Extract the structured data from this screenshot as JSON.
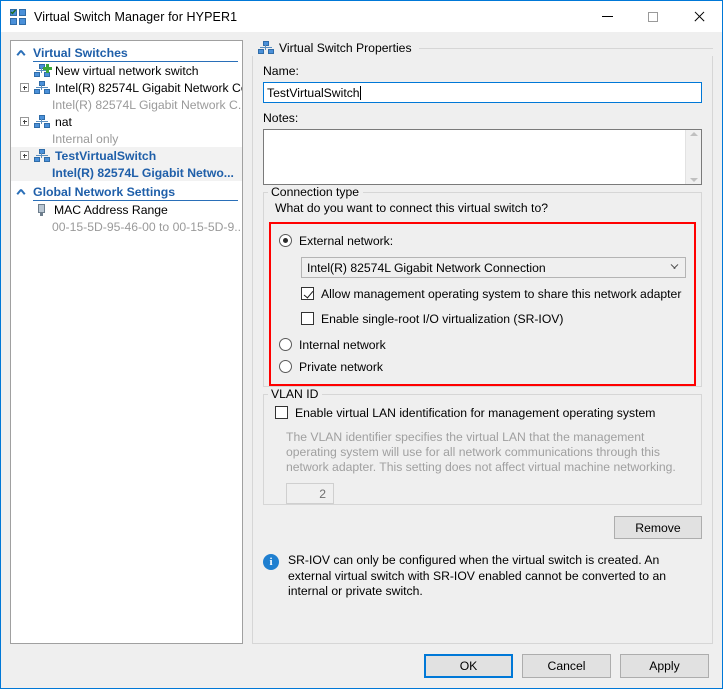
{
  "window": {
    "title": "Virtual Switch Manager for HYPER1",
    "icon": "virtual-switch-manager-icon",
    "minimize_label": "Minimize",
    "maximize_label": "Maximize",
    "close_label": "Close"
  },
  "tree": {
    "sections": [
      {
        "label": "Virtual Switches",
        "collapse_icon": "chevron-up-icon",
        "items": [
          {
            "label": "New virtual network switch",
            "sub": null,
            "icon": "new-virtual-switch-icon",
            "expandable": false,
            "selected": false,
            "highlight": false
          },
          {
            "label": "Intel(R) 82574L Gigabit Network Co...",
            "sub": "Intel(R) 82574L Gigabit Network C...",
            "icon": "virtual-switch-icon",
            "expandable": true,
            "selected": false,
            "highlight": false
          },
          {
            "label": "nat",
            "sub": "Internal only",
            "icon": "virtual-switch-icon",
            "expandable": true,
            "selected": false,
            "highlight": false
          },
          {
            "label": "TestVirtualSwitch",
            "sub": "Intel(R) 82574L Gigabit Netwo...",
            "icon": "virtual-switch-icon",
            "expandable": true,
            "selected": true,
            "highlight": true
          }
        ]
      },
      {
        "label": "Global Network Settings",
        "collapse_icon": "chevron-up-icon",
        "items": [
          {
            "label": "MAC Address Range",
            "sub": "00-15-5D-95-46-00 to 00-15-5D-9...",
            "icon": "mac-address-range-icon",
            "expandable": false,
            "selected": false,
            "highlight": false
          }
        ]
      }
    ]
  },
  "properties": {
    "group_title": "Virtual Switch Properties",
    "group_icon": "virtual-switch-icon",
    "name_label": "Name:",
    "name_value": "TestVirtualSwitch",
    "notes_label": "Notes:",
    "notes_value": "",
    "scroll_up_icon": "scroll-up-arrow-icon",
    "scroll_down_icon": "scroll-down-arrow-icon"
  },
  "connection_type": {
    "legend": "Connection type",
    "question": "What do you want to connect this virtual switch to?",
    "highlight_color": "#ff0000",
    "external": {
      "label": "External network:",
      "selected": true,
      "adapter_value": "Intel(R) 82574L Gigabit Network Connection",
      "adapter_arrow_icon": "chevron-down-icon",
      "allow_management": {
        "label": "Allow management operating system to share this network adapter",
        "checked": true
      },
      "sriov": {
        "label": "Enable single-root I/O virtualization (SR-IOV)",
        "checked": false
      }
    },
    "internal": {
      "label": "Internal network",
      "selected": false
    },
    "private": {
      "label": "Private network",
      "selected": false
    }
  },
  "vlan": {
    "legend": "VLAN ID",
    "enable": {
      "label": "Enable virtual LAN identification for management operating system",
      "checked": false
    },
    "description": "The VLAN identifier specifies the virtual LAN that the management operating system will use for all network communications through this network adapter. This setting does not affect virtual machine networking.",
    "value": "2"
  },
  "actions": {
    "remove_label": "Remove"
  },
  "info": {
    "icon": "information-icon",
    "text": "SR-IOV can only be configured when the virtual switch is created. An external virtual switch with SR-IOV enabled cannot be converted to an internal or private switch."
  },
  "footer": {
    "ok_label": "OK",
    "cancel_label": "Cancel",
    "apply_label": "Apply"
  }
}
